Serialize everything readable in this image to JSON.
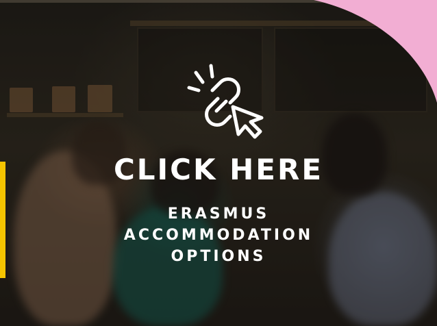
{
  "banner": {
    "cta_title": "CLICK HERE",
    "cta_subtitle_lines": [
      "ERASMUS",
      "ACCOMMODATION",
      "OPTIONS"
    ],
    "icon": "link-click-icon",
    "colors": {
      "text": "#ffffff",
      "accent_pink": "#f2aed3",
      "accent_yellow": "#f5c400"
    }
  }
}
